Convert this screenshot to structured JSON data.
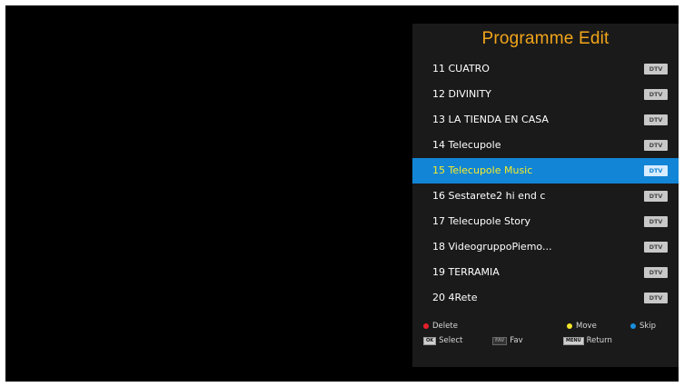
{
  "panel": {
    "title": "Programme Edit"
  },
  "channels": [
    {
      "label": "11 CUATRO",
      "badge": "DTV"
    },
    {
      "label": "12 DIVINITY",
      "badge": "DTV"
    },
    {
      "label": "13 LA TIENDA EN CASA",
      "badge": "DTV"
    },
    {
      "label": "14 Telecupole",
      "badge": "DTV"
    },
    {
      "label": "15 Telecupole Music",
      "badge": "DTV",
      "selected": true
    },
    {
      "label": "16 Sestarete2 hi end c",
      "badge": "DTV"
    },
    {
      "label": "17 Telecupole Story",
      "badge": "DTV"
    },
    {
      "label": "18 VideogruppoPiemo...",
      "badge": "DTV"
    },
    {
      "label": "19 TERRAMIA",
      "badge": "DTV"
    },
    {
      "label": "20 4Rete",
      "badge": "DTV"
    }
  ],
  "legend": {
    "delete": {
      "label": "Delete",
      "color": "#e8202a",
      "icon": "red-dot-icon"
    },
    "move": {
      "label": "Move",
      "color": "#f3e62a",
      "icon": "yellow-dot-icon"
    },
    "skip": {
      "label": "Skip",
      "color": "#1a8fe0",
      "icon": "blue-dot-icon"
    },
    "select": {
      "label": "Select",
      "key": "OK",
      "icon": "ok-key-icon"
    },
    "fav": {
      "label": "Fav",
      "key": "FAV",
      "icon": "fav-key-icon"
    },
    "return": {
      "label": "Return",
      "key": "MENU",
      "icon": "menu-key-icon"
    }
  },
  "colors": {
    "title": "#f2a51a",
    "selection": "#1285d6",
    "selected_text": "#f6ec2a"
  }
}
